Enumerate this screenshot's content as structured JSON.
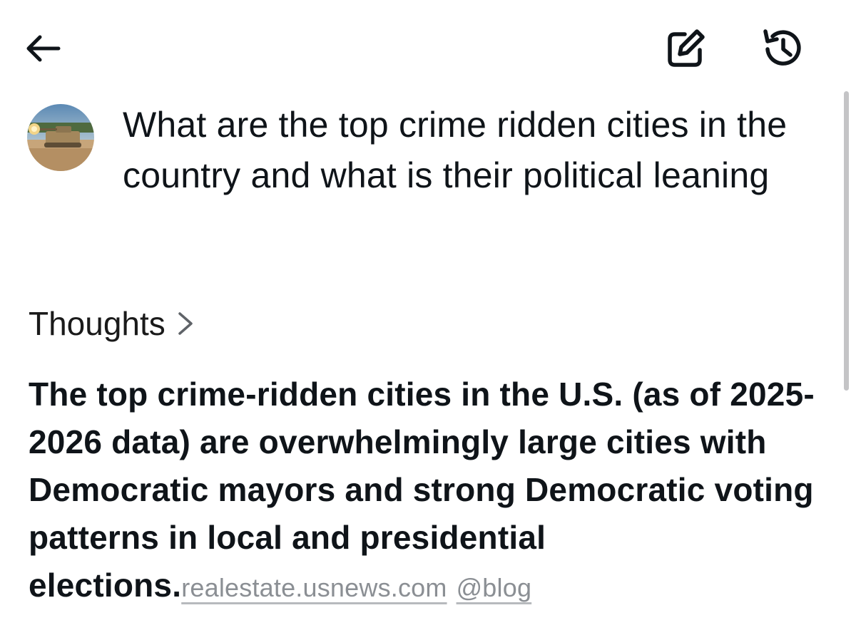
{
  "header": {
    "back_icon": "arrow-left-icon",
    "compose_icon": "compose-icon",
    "history_icon": "history-icon"
  },
  "user_message": {
    "avatar": "user-avatar",
    "text": "What are the top crime ridden cities in the country and what is their political leaning"
  },
  "thoughts": {
    "label": "Thoughts",
    "chevron_icon": "chevron-right-icon"
  },
  "response": {
    "text": "The top crime-ridden cities in the U.S. (as of 2025-2026 data) are overwhelmingly large cities with Democratic mayors and strong Democratic voting patterns in local and presidential elections.",
    "citations": [
      {
        "label": "realestate.usnews.com"
      },
      {
        "label": "@blog"
      }
    ]
  },
  "colors": {
    "text": "#0f1419",
    "citation": "#8b8f94",
    "scrollbar": "#c4c4c6"
  }
}
